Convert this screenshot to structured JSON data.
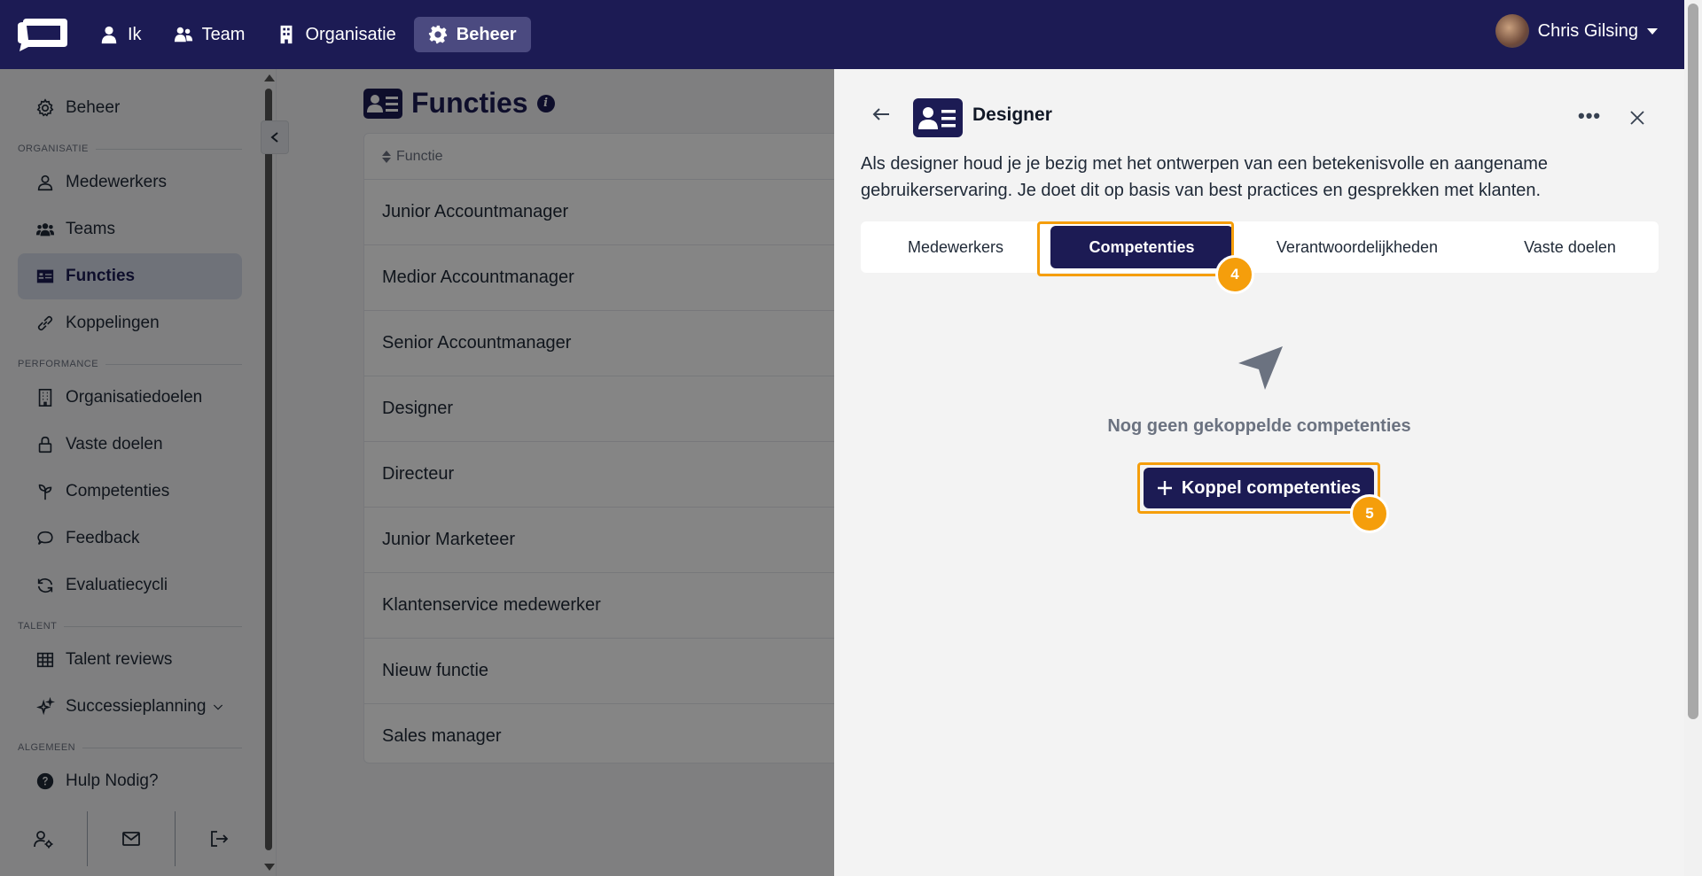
{
  "topnav": {
    "items": [
      {
        "label": "Ik",
        "icon": "user-icon"
      },
      {
        "label": "Team",
        "icon": "users-icon"
      },
      {
        "label": "Organisatie",
        "icon": "building-icon"
      },
      {
        "label": "Beheer",
        "icon": "gear-icon",
        "active": true
      }
    ],
    "user_name": "Chris Gilsing"
  },
  "sidebar": {
    "top_item": "Beheer",
    "sections": [
      "ORGANISATIE",
      "PERFORMANCE",
      "TALENT",
      "ALGEMEEN"
    ],
    "items": [
      {
        "label": "Medewerkers",
        "icon": "user-icon"
      },
      {
        "label": "Teams",
        "icon": "users-icon"
      },
      {
        "label": "Functies",
        "icon": "id-card-icon",
        "active": true
      },
      {
        "label": "Koppelingen",
        "icon": "link-icon"
      },
      {
        "label": "Organisatiedoelen",
        "icon": "building-icon"
      },
      {
        "label": "Vaste doelen",
        "icon": "lock-icon"
      },
      {
        "label": "Competenties",
        "icon": "sprout-icon"
      },
      {
        "label": "Feedback",
        "icon": "chat-icon"
      },
      {
        "label": "Evaluatiecycli",
        "icon": "refresh-icon"
      },
      {
        "label": "Talent reviews",
        "icon": "grid-icon"
      },
      {
        "label": "Successieplanning",
        "icon": "sparkle-icon"
      },
      {
        "label": "Hulp Nodig?",
        "icon": "help-icon"
      }
    ]
  },
  "main": {
    "title": "Functies",
    "column_header": "Functie",
    "rows": [
      "Junior Accountmanager",
      "Medior Accountmanager",
      "Senior Accountmanager",
      "Designer",
      "Directeur",
      "Junior Marketeer",
      "Klantenservice medewerker",
      "Nieuw functie",
      "Sales manager"
    ]
  },
  "drawer": {
    "title": "Designer",
    "more": "•••",
    "description": "Als designer houd je je bezig met het ontwerpen van een betekenisvolle en aangename gebruikerservaring. Je doet dit op basis van best practices en gesprekken met klanten.",
    "tabs": [
      "Medewerkers",
      "Competenties",
      "Verantwoordelijkheden",
      "Vaste doelen"
    ],
    "active_tab": "Competenties",
    "empty_text": "Nog geen gekoppelde competenties",
    "button_label": "Koppel competenties",
    "badges": [
      "4",
      "5"
    ]
  },
  "colors": {
    "brand": "#1c1b54",
    "highlight": "#f59e0b"
  }
}
